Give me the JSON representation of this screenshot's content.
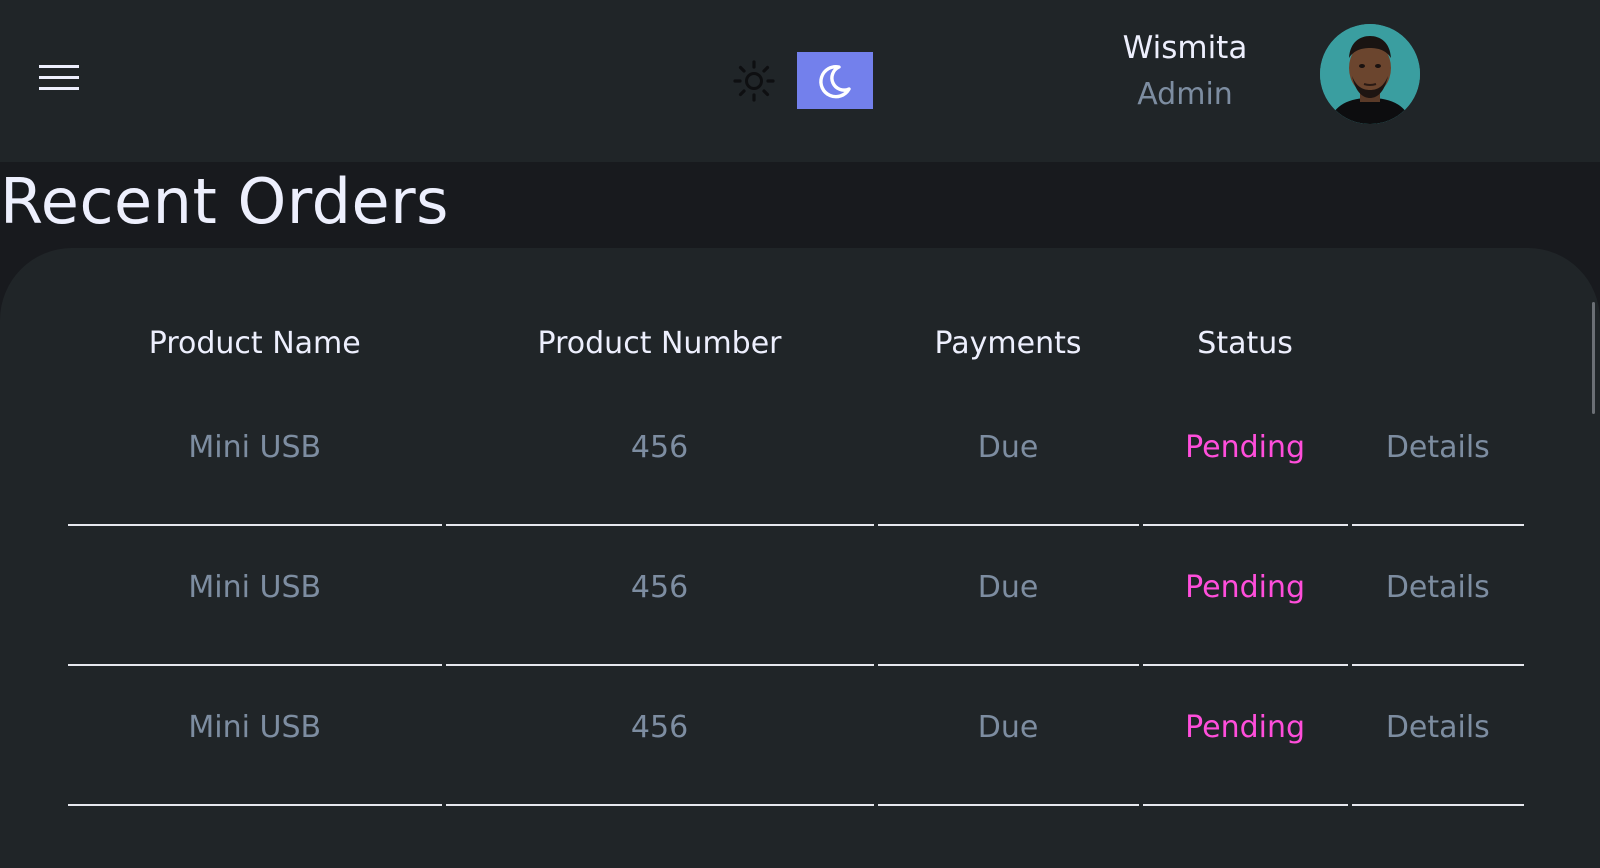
{
  "header": {
    "menu_icon": "menu-icon",
    "theme_toggle": {
      "light_icon": "sun-icon",
      "dark_icon": "moon-icon",
      "active": "dark",
      "accent": "#7380ec"
    },
    "profile": {
      "name": "Wismita",
      "role": "Admin",
      "avatar": "user-avatar"
    }
  },
  "main": {
    "title": "Recent Orders",
    "table": {
      "columns": [
        "Product Name",
        "Product Number",
        "Payments",
        "Status",
        ""
      ],
      "rows": [
        {
          "product_name": "Mini USB",
          "product_number": "456",
          "payment": "Due",
          "status": "Pending",
          "action": "Details"
        },
        {
          "product_name": "Mini USB",
          "product_number": "456",
          "payment": "Due",
          "status": "Pending",
          "action": "Details"
        },
        {
          "product_name": "Mini USB",
          "product_number": "456",
          "payment": "Due",
          "status": "Pending",
          "action": "Details"
        }
      ]
    }
  },
  "colors": {
    "background": "#181a1e",
    "surface": "#202528",
    "primary_text": "#edeffd",
    "muted_text": "#7d8da1",
    "status_pending": "#ff4edb"
  }
}
